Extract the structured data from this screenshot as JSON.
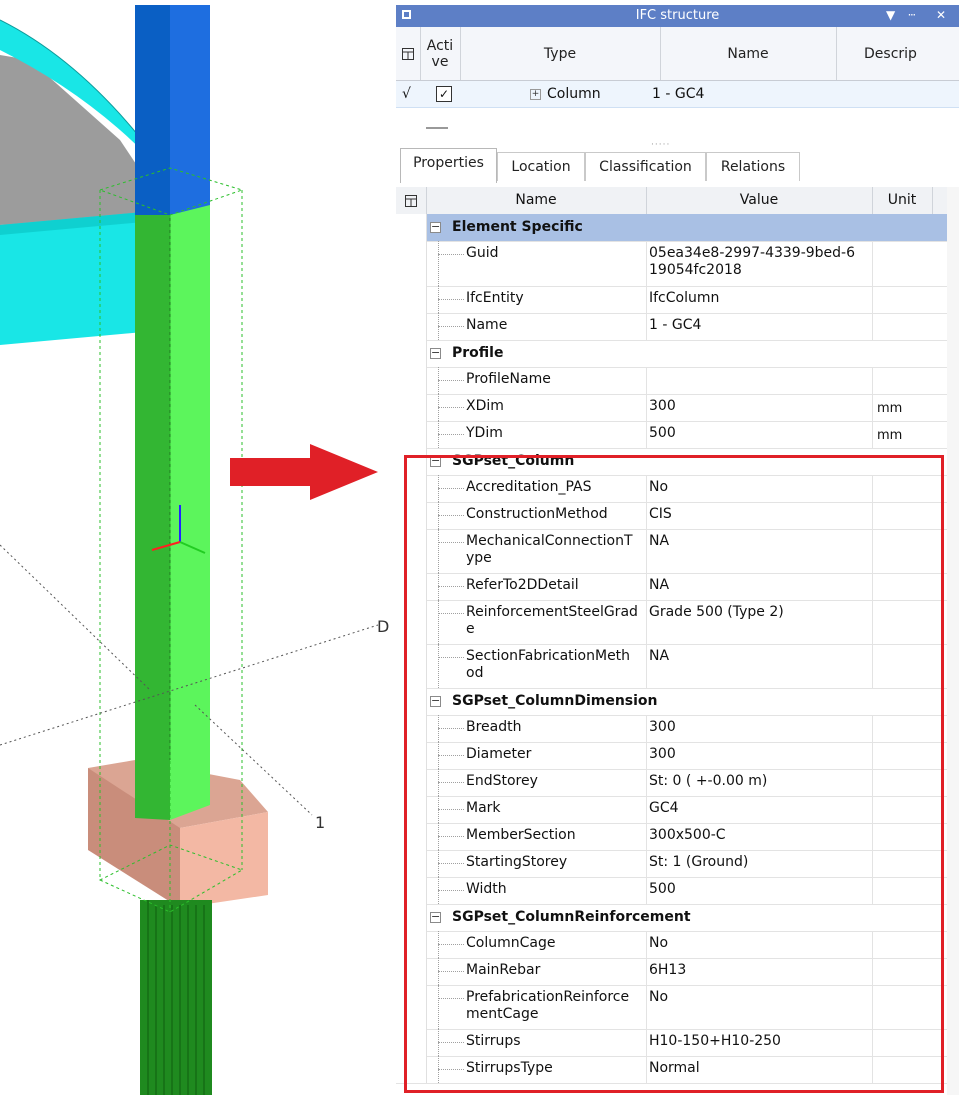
{
  "viewport": {
    "label_d": "D",
    "label_1": "1"
  },
  "ifc": {
    "title": "IFC structure",
    "controls": [
      "▼",
      "ⵈ",
      "✕"
    ],
    "columns": [
      "Acti\nve",
      "Type",
      "Name",
      "Descrip"
    ],
    "row": {
      "marker": "√",
      "type": "Column",
      "name": "1 - GC4",
      "active": true
    }
  },
  "tabs": [
    "Properties",
    "Location",
    "Classification",
    "Relations"
  ],
  "props": {
    "headers": [
      "Name",
      "Value",
      "Unit"
    ],
    "rows": [
      {
        "kind": "group",
        "label": "Element Specific",
        "selected": true
      },
      {
        "kind": "prop",
        "name": "Guid",
        "value": "05ea34e8-2997-4339-9bed-6\n19054fc2018",
        "unit": ""
      },
      {
        "kind": "prop",
        "name": "IfcEntity",
        "value": "IfcColumn",
        "unit": ""
      },
      {
        "kind": "prop",
        "name": "Name",
        "value": "1 - GC4",
        "unit": ""
      },
      {
        "kind": "group",
        "label": "Profile"
      },
      {
        "kind": "prop",
        "name": "ProfileName",
        "value": "",
        "unit": ""
      },
      {
        "kind": "prop",
        "name": "XDim",
        "value": "300",
        "unit": "mm"
      },
      {
        "kind": "prop",
        "name": "YDim",
        "value": "500",
        "unit": "mm"
      },
      {
        "kind": "group",
        "label": "SGPset_Column"
      },
      {
        "kind": "prop",
        "name": "Accreditation_PAS",
        "value": "No",
        "unit": ""
      },
      {
        "kind": "prop",
        "name": "ConstructionMethod",
        "value": "CIS",
        "unit": ""
      },
      {
        "kind": "prop",
        "name": "MechanicalConnectionT\nype",
        "value": "NA",
        "unit": ""
      },
      {
        "kind": "prop",
        "name": "ReferTo2DDetail",
        "value": "NA",
        "unit": ""
      },
      {
        "kind": "prop",
        "name": "ReinforcementSteelGrad\ne",
        "value": "Grade 500 (Type 2)",
        "unit": ""
      },
      {
        "kind": "prop",
        "name": "SectionFabricationMeth\nod",
        "value": "NA",
        "unit": ""
      },
      {
        "kind": "group",
        "label": "SGPset_ColumnDimension"
      },
      {
        "kind": "prop",
        "name": "Breadth",
        "value": "300",
        "unit": ""
      },
      {
        "kind": "prop",
        "name": "Diameter",
        "value": "300",
        "unit": ""
      },
      {
        "kind": "prop",
        "name": "EndStorey",
        "value": "St: 0 ( +-0.00 m)",
        "unit": ""
      },
      {
        "kind": "prop",
        "name": "Mark",
        "value": "GC4",
        "unit": ""
      },
      {
        "kind": "prop",
        "name": "MemberSection",
        "value": "300x500-C",
        "unit": ""
      },
      {
        "kind": "prop",
        "name": "StartingStorey",
        "value": "St: 1 (Ground)",
        "unit": ""
      },
      {
        "kind": "prop",
        "name": "Width",
        "value": "500",
        "unit": ""
      },
      {
        "kind": "group",
        "label": "SGPset_ColumnReinforcement"
      },
      {
        "kind": "prop",
        "name": "ColumnCage",
        "value": "No",
        "unit": ""
      },
      {
        "kind": "prop",
        "name": "MainRebar",
        "value": "6H13",
        "unit": ""
      },
      {
        "kind": "prop",
        "name": "PrefabricationReinforce\nmentCage",
        "value": "No",
        "unit": ""
      },
      {
        "kind": "prop",
        "name": "Stirrups",
        "value": "H10-150+H10-250",
        "unit": ""
      },
      {
        "kind": "prop",
        "name": "StirrupsType",
        "value": "Normal",
        "unit": ""
      }
    ]
  },
  "colors": {
    "column_green": "#5cf55c",
    "slab_cyan": "#19e6e6",
    "beam_blue": "#0a5fc4",
    "footing": "#f3b8a4",
    "highlight_red": "#e02027",
    "title_blue": "#5d7fc6",
    "selected_group": "#a9c0e4"
  }
}
